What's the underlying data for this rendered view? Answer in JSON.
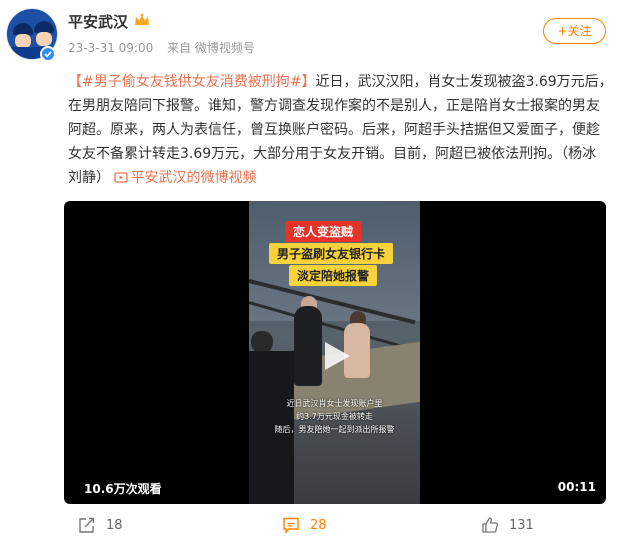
{
  "user": {
    "name": "平安武汉",
    "time": "23-3-31 09:00",
    "source": "来自 微博视频号",
    "follow_label": "+关注"
  },
  "post": {
    "hashtag": "【#男子偷女友钱供女友消费被刑拘#】",
    "body": "近日，武汉汉阳，肖女士发现被盗3.69万元后，在男朋友陪同下报警。谁知，警方调查发现作案的不是别人，正是陪肖女士报案的男友阿超。原来，两人为表信任，曾互换账户密码。后来，阿超手头拮据但又爱面子，便趁女友不备累计转走3.69万元，大部分用于女友开销。目前，阿超已被依法刑拘。（杨冰 刘静）",
    "video_link": "平安武汉的微博视频"
  },
  "video": {
    "caption_red": "恋人变盗贼",
    "caption_yellow1": "男子盗刷女友银行卡",
    "caption_yellow2": "淡定陪她报警",
    "subtitle1": "近日武汉肖女士发现账户里",
    "subtitle2": "约3.7万元现金被转走",
    "subtitle3": "随后，男友陪她一起到派出所报警",
    "views": "10.6万次观看",
    "duration": "00:11"
  },
  "actions": {
    "repost": "18",
    "comment": "28",
    "like": "131"
  },
  "colors": {
    "accent": "#ff8200",
    "link": "#eb7350"
  }
}
